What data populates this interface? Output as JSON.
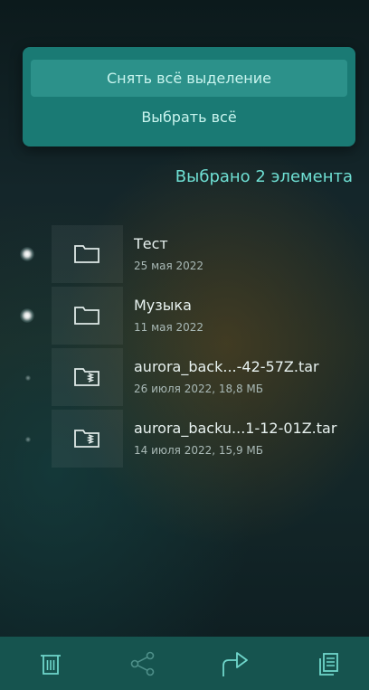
{
  "menu": {
    "deselect_label": "Снять всё выделение",
    "select_all_label": "Выбрать всё"
  },
  "selection": {
    "count_text": "Выбрано 2 элемента"
  },
  "files": [
    {
      "name": "Тест",
      "meta": "25 мая 2022",
      "type": "folder",
      "selected": true
    },
    {
      "name": "Музыка",
      "meta": "11 мая 2022",
      "type": "folder",
      "selected": true
    },
    {
      "name": "aurora_back...-42-57Z.tar",
      "meta": "26 июля 2022, 18,8 МБ",
      "type": "archive",
      "selected": false
    },
    {
      "name": "aurora_backu...1-12-01Z.tar",
      "meta": "14 июля 2022, 15,9 МБ",
      "type": "archive",
      "selected": false
    }
  ],
  "toolbar": {
    "buttons": [
      {
        "icon": "trash-icon",
        "enabled": true
      },
      {
        "icon": "share-icon",
        "enabled": false
      },
      {
        "icon": "send-arrow-icon",
        "enabled": true
      },
      {
        "icon": "copy-icon",
        "enabled": true
      }
    ]
  },
  "colors": {
    "accent": "#6fe0d4",
    "panel": "#1a7a74",
    "toolbar": "#16544f"
  }
}
